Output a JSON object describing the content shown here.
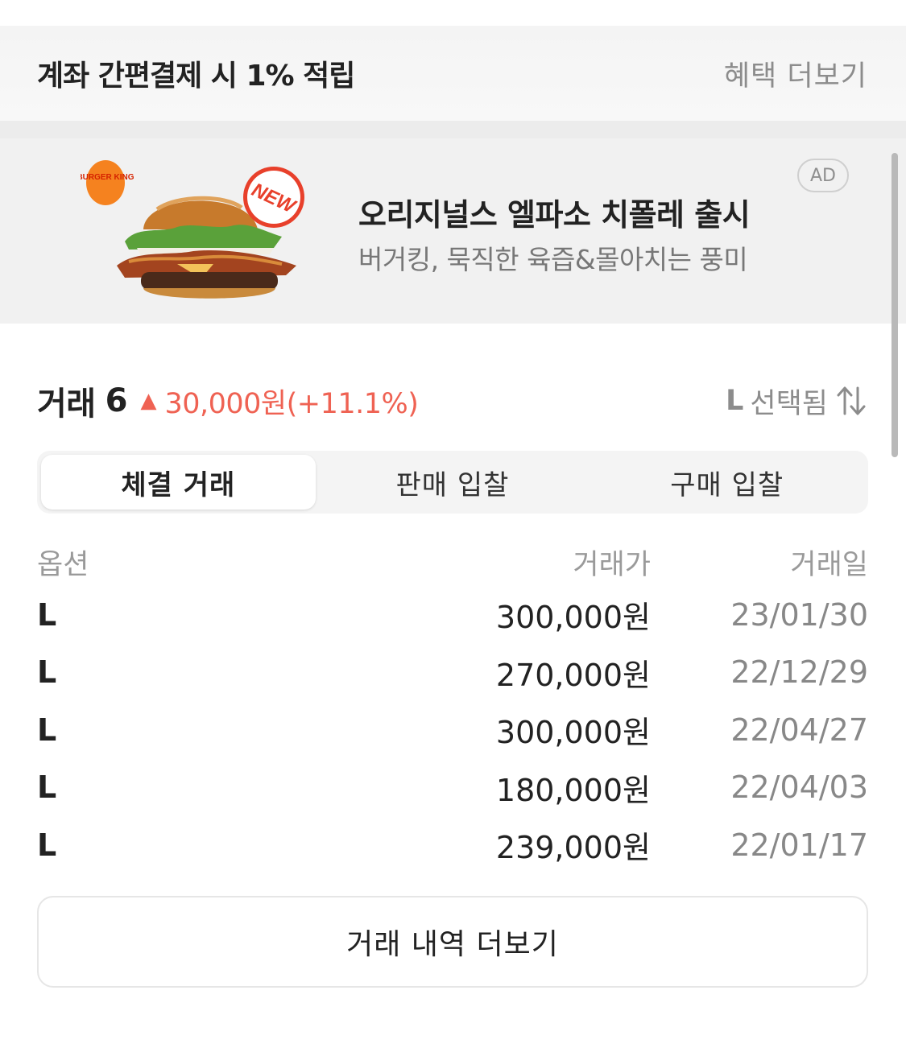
{
  "benefit": {
    "title": "계좌 간편결제 시 1% 적립",
    "more": "혜택 더보기"
  },
  "ad": {
    "badge": "AD",
    "title": "오리지널스 엘파소 치폴레 출시",
    "subtitle": "버거킹, 묵직한 육즙&몰아치는 풍미",
    "brand_logo": "BURGER KING",
    "new_label": "NEW"
  },
  "trade": {
    "title": "거래",
    "count": "6",
    "change": "30,000원(+11.1%)",
    "option_size": "L",
    "option_label": "선택됨",
    "up_icon": "triangle-up-icon",
    "sort_icon": "sort-arrows-icon"
  },
  "tabs": [
    {
      "label": "체결 거래",
      "active": true
    },
    {
      "label": "판매 입찰",
      "active": false
    },
    {
      "label": "구매 입찰",
      "active": false
    }
  ],
  "table": {
    "headers": {
      "option": "옵션",
      "price": "거래가",
      "date": "거래일"
    },
    "rows": [
      {
        "option": "L",
        "price": "300,000원",
        "date": "23/01/30"
      },
      {
        "option": "L",
        "price": "270,000원",
        "date": "22/12/29"
      },
      {
        "option": "L",
        "price": "300,000원",
        "date": "22/04/27"
      },
      {
        "option": "L",
        "price": "180,000원",
        "date": "22/04/03"
      },
      {
        "option": "L",
        "price": "239,000원",
        "date": "22/01/17"
      }
    ]
  },
  "more_button": "거래 내역 더보기",
  "colors": {
    "accent_red": "#ef6253",
    "muted_text": "#8c8c8c",
    "banner_bg": "#f1f1f1"
  }
}
